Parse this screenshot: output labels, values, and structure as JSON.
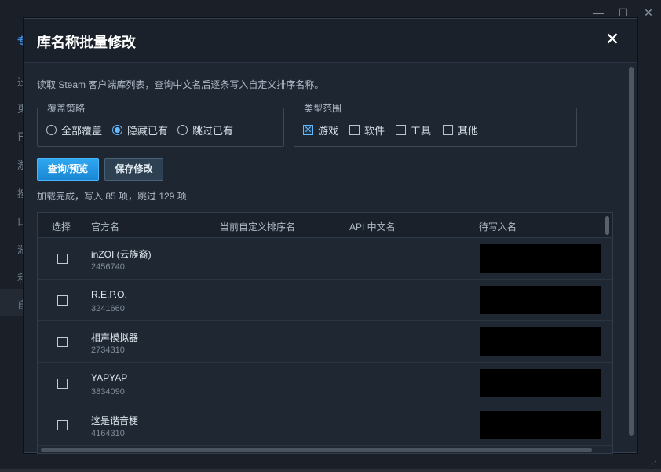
{
  "window": {
    "minimize_glyph": "—",
    "maximize_glyph": "☐",
    "close_glyph": "✕",
    "sidebar_fragments": [
      "录",
      "过",
      "更",
      "已",
      "游",
      "按",
      "口",
      "游",
      "和",
      "自"
    ],
    "header_fragment": "专"
  },
  "dialog": {
    "title": "库名称批量修改",
    "close_glyph": "✕",
    "description": "读取 Steam 客户端库列表，查询中文名后逐条写入自定义排序名称。",
    "overwrite": {
      "legend": "覆盖策略",
      "options": [
        {
          "label": "全部覆盖",
          "selected": false
        },
        {
          "label": "隐藏已有",
          "selected": true
        },
        {
          "label": "跳过已有",
          "selected": false
        }
      ]
    },
    "scope": {
      "legend": "类型范围",
      "options": [
        {
          "label": "游戏",
          "checked": true
        },
        {
          "label": "软件",
          "checked": false
        },
        {
          "label": "工具",
          "checked": false
        },
        {
          "label": "其他",
          "checked": false
        }
      ]
    },
    "query_button": "查询/预览",
    "save_button": "保存修改",
    "status": "加载完成，写入 85 项，跳过 129 项",
    "table": {
      "headers": [
        "选择",
        "官方名",
        "当前自定义排序名",
        "API 中文名",
        "待写入名"
      ],
      "rows": [
        {
          "name": "inZOI (云族裔)",
          "id": "2456740",
          "pending": ""
        },
        {
          "name": "R.E.P.O.",
          "id": "3241660",
          "pending": ""
        },
        {
          "name": "相声模拟器",
          "id": "2734310",
          "pending": ""
        },
        {
          "name": "YAPYAP",
          "id": "3834090",
          "pending": ""
        },
        {
          "name": "这是谐音梗",
          "id": "4164310",
          "pending": ""
        }
      ]
    }
  },
  "colors": {
    "accent": "#66b8ff",
    "primary_button": "#1a86d4",
    "dialog_bg": "#1e2632"
  }
}
